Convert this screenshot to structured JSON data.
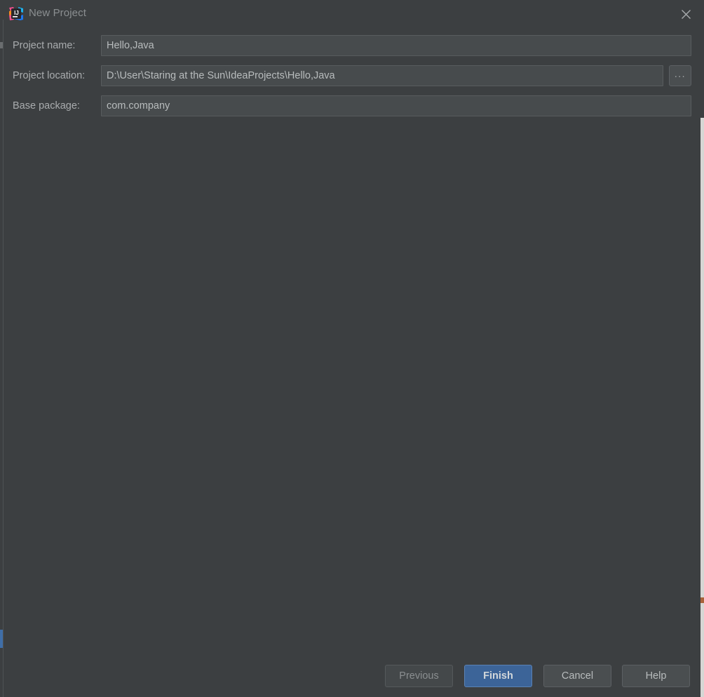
{
  "window": {
    "title": "New Project",
    "icon": "intellij-idea-logo-icon",
    "close_icon": "close-icon",
    "background_color": "#3c3f41"
  },
  "form": {
    "fields": [
      {
        "label": "Project name:",
        "value": "Hello,Java",
        "placeholder": "",
        "name": "project-name"
      },
      {
        "label": "Project location:",
        "value": "D:\\User\\Staring at the Sun\\IdeaProjects\\Hello,Java",
        "placeholder": "",
        "name": "project-location"
      },
      {
        "label": "Base package:",
        "value": "com.company",
        "placeholder": "",
        "name": "base-package"
      }
    ],
    "browse_button": {
      "label": "...",
      "name": "browse-folder-button"
    }
  },
  "footer": {
    "buttons": [
      {
        "label": "Previous",
        "state": "disabled",
        "name": "previous-button"
      },
      {
        "label": "Finish",
        "state": "primary",
        "name": "finish-button"
      },
      {
        "label": "Cancel",
        "state": "normal",
        "name": "cancel-button"
      },
      {
        "label": "Help",
        "state": "normal",
        "name": "help-button"
      }
    ]
  },
  "colors": {
    "dialog_background": "#3c3f41",
    "input_background": "#474b4d",
    "input_border": "#585c5e",
    "label_text": "#a9acae",
    "value_text": "#b8bcbd",
    "title_text": "#8b8f91",
    "primary_button": "#3c6498",
    "primary_button_border": "#5a82b4",
    "button_background": "#4a4e50",
    "disabled_text": "#8b8f91"
  }
}
